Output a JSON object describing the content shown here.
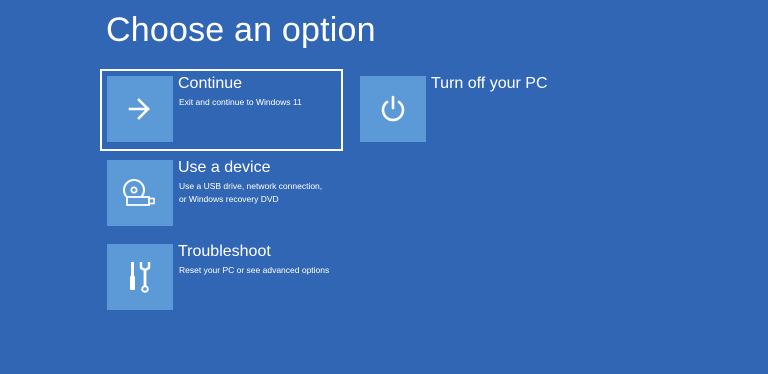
{
  "page": {
    "title": "Choose an option"
  },
  "options": [
    {
      "id": "continue",
      "title": "Continue",
      "description": "Exit and continue to Windows 11",
      "icon": "arrow-right-icon",
      "selected": true
    },
    {
      "id": "use-device",
      "title": "Use a device",
      "description": "Use a USB drive, network connection,\nor Windows recovery DVD",
      "icon": "disc-usb-icon",
      "selected": false
    },
    {
      "id": "troubleshoot",
      "title": "Troubleshoot",
      "description": "Reset your PC or see advanced options",
      "icon": "tools-icon",
      "selected": false
    },
    {
      "id": "turn-off",
      "title": "Turn off your PC",
      "description": "",
      "icon": "power-icon",
      "selected": false
    }
  ],
  "colors": {
    "background": "#3166b4",
    "tile": "#5b9ad6",
    "text": "#ffffff"
  }
}
